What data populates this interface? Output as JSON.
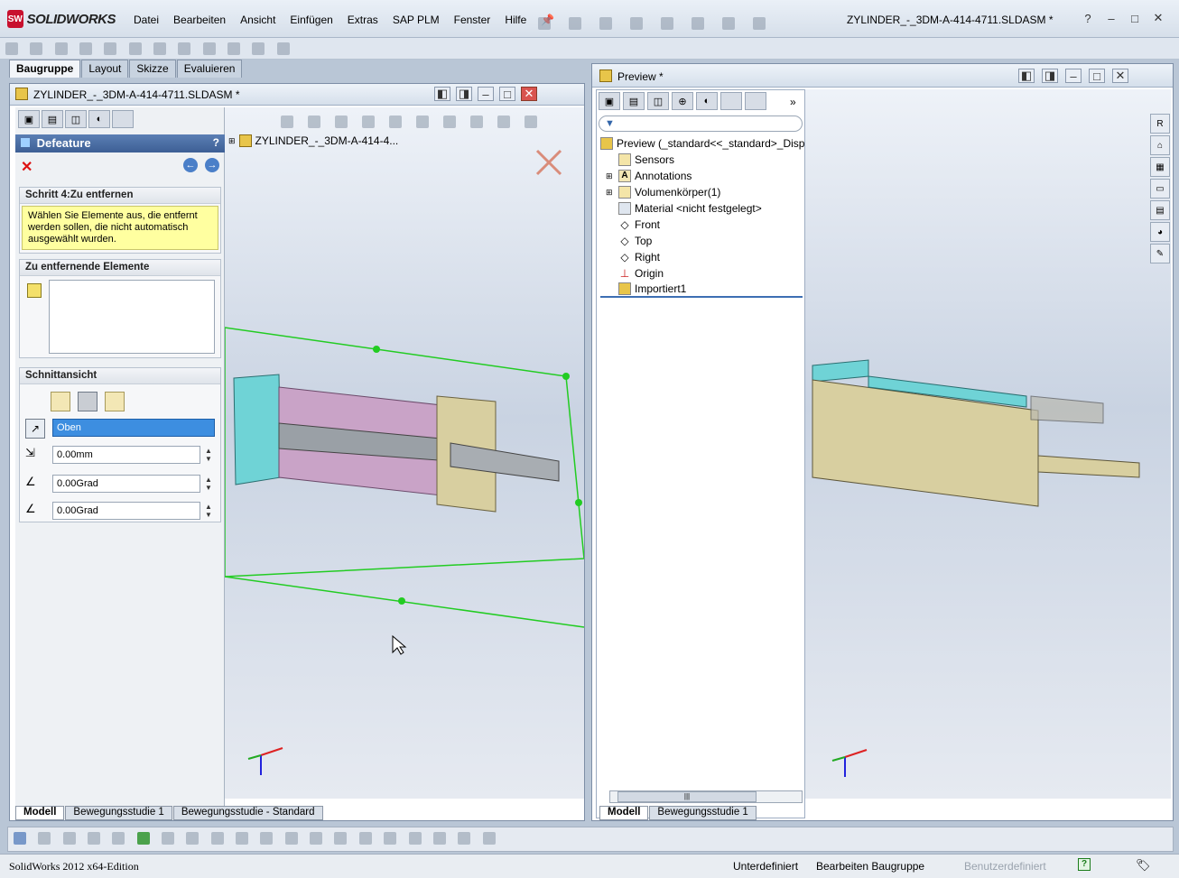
{
  "app": {
    "logo_text": "SOLIDWORKS",
    "title": "ZYLINDER_-_3DM-A-414-4711.SLDASM *"
  },
  "menu": [
    "Datei",
    "Bearbeiten",
    "Ansicht",
    "Einfügen",
    "Extras",
    "SAP PLM",
    "Fenster",
    "Hilfe"
  ],
  "cm_tabs": [
    "Baugruppe",
    "Layout",
    "Skizze",
    "Evaluieren"
  ],
  "doc_left": {
    "title": "ZYLINDER_-_3DM-A-414-4711.SLDASM *",
    "tree_root": "ZYLINDER_-_3DM-A-414-4...",
    "bottom_tabs": [
      "Modell",
      "Bewegungsstudie 1",
      "Bewegungsstudie - Standard"
    ]
  },
  "property_manager": {
    "title": "Defeature",
    "step_group": {
      "title": "Schritt 4:Zu entfernen",
      "message": "Wählen Sie Elemente aus, die entfernt werden sollen, die nicht automatisch ausgewählt wurden."
    },
    "remove_group": {
      "title": "Zu entfernende Elemente"
    },
    "section_group": {
      "title": "Schnittansicht",
      "plane": "Oben",
      "offset": "0.00mm",
      "angle_x": "0.00Grad",
      "angle_y": "0.00Grad"
    }
  },
  "doc_right": {
    "title": "Preview *",
    "tree": {
      "root": "Preview  (_standard<<_standard>_Displ",
      "items": [
        "Sensors",
        "Annotations",
        "Volumenkörper(1)",
        "Material <nicht festgelegt>",
        "Front",
        "Top",
        "Right",
        "Origin",
        "Importiert1"
      ]
    },
    "bottom_tabs": [
      "Modell",
      "Bewegungsstudie 1"
    ]
  },
  "statusbar": {
    "edition": "SolidWorks 2012 x64-Edition",
    "state": "Unterdefiniert",
    "mode": "Bearbeiten Baugruppe",
    "units": "Benutzerdefiniert"
  },
  "colors": {
    "accent": "#3d5f95",
    "section_plane": "#22cc22",
    "cyan_part": "#6fd3d6",
    "tan_part": "#d8cfa0"
  }
}
